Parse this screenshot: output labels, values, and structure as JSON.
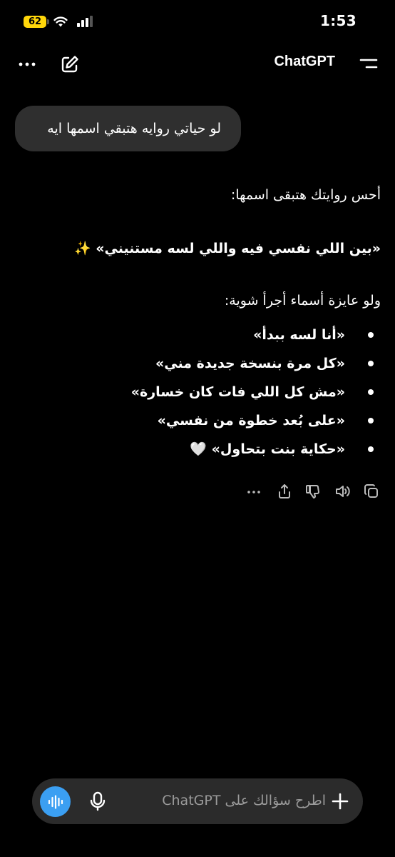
{
  "status_bar": {
    "time": "1:53",
    "battery_level": "62",
    "battery_color": "#ffd60a"
  },
  "header": {
    "title": "ChatGPT"
  },
  "conversation": {
    "user_message": "لو حياتي روايه هتبقي اسمها ايه",
    "assistant": {
      "intro": "أحس روايتك هتبقى اسمها:",
      "title_suggestion": "«بين اللي نفسي فيه واللي لسه مستنيني» ✨",
      "alternatives_intro": "ولو عايزة أسماء أجرأ شوية:",
      "alternatives": [
        "«أنا لسه ببدأ»",
        "«كل مرة بنسخة جديدة مني»",
        "«مش كل اللي فات كان خسارة»",
        "«على بُعد خطوة من نفسي»",
        "«حكاية بنت بتحاول» 🤍"
      ]
    }
  },
  "message_actions": [
    "copy-icon",
    "speaker-icon",
    "thumbs-down-icon",
    "share-icon",
    "more-icon"
  ],
  "composer": {
    "placeholder": "اطرح سؤالك على ChatGPT",
    "accent_color": "#3b9ff2"
  }
}
